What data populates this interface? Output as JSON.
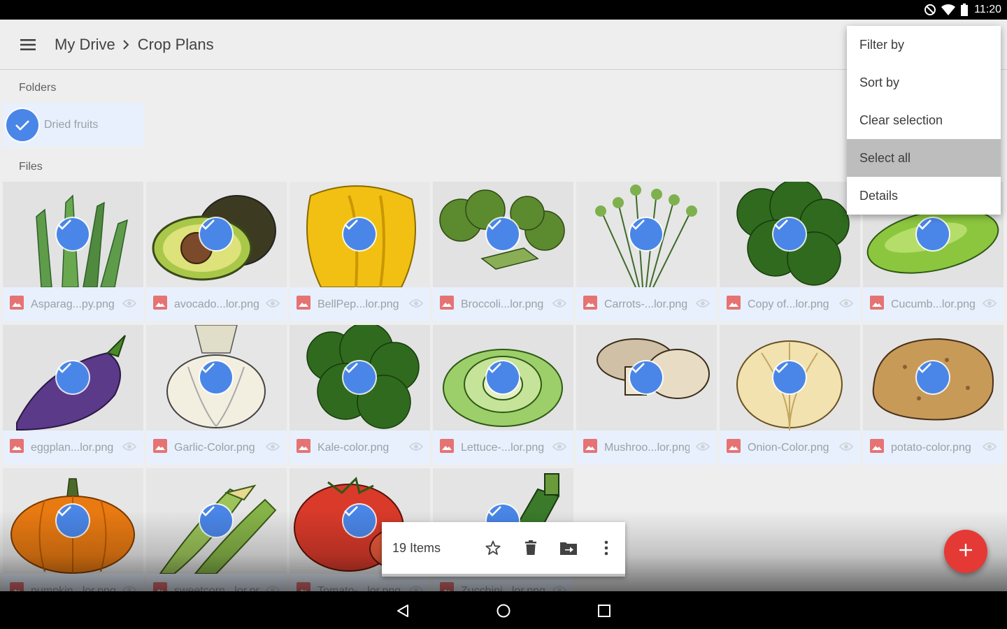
{
  "status_bar": {
    "time": "11:20",
    "icons": [
      "do-not-disturb-icon",
      "wifi-icon",
      "battery-icon"
    ]
  },
  "app_bar": {
    "menu_icon": "hamburger-menu-icon",
    "breadcrumb": [
      "My Drive",
      "Crop Plans"
    ]
  },
  "folders_section": {
    "label": "Folders",
    "items": [
      {
        "name": "Dried fruits",
        "selected": true
      }
    ]
  },
  "files_section": {
    "label": "Files",
    "items": [
      {
        "name": "Asparag...py.png",
        "subject": "asparagus",
        "selected": true
      },
      {
        "name": "avocado...lor.png",
        "subject": "avocado",
        "selected": true
      },
      {
        "name": "BellPep...lor.png",
        "subject": "bell-pepper",
        "selected": true
      },
      {
        "name": "Broccoli...lor.png",
        "subject": "broccoli",
        "selected": true
      },
      {
        "name": "Carrots-...lor.png",
        "subject": "carrots",
        "selected": true
      },
      {
        "name": "Copy of...lor.png",
        "subject": "kale",
        "selected": true
      },
      {
        "name": "Cucumb...lor.png",
        "subject": "cucumber",
        "selected": true
      },
      {
        "name": "eggplan...lor.png",
        "subject": "eggplant",
        "selected": true
      },
      {
        "name": "Garlic-Color.png",
        "subject": "garlic",
        "selected": true
      },
      {
        "name": "Kale-color.png",
        "subject": "kale",
        "selected": true
      },
      {
        "name": "Lettuce-...lor.png",
        "subject": "lettuce",
        "selected": true
      },
      {
        "name": "Mushroo...lor.png",
        "subject": "mushrooms",
        "selected": true
      },
      {
        "name": "Onion-Color.png",
        "subject": "onion",
        "selected": true
      },
      {
        "name": "potato-color.png",
        "subject": "potato",
        "selected": true
      },
      {
        "name": "pumpkin...lor.png",
        "subject": "pumpkin",
        "selected": true
      },
      {
        "name": "sweetcorn...lor.png",
        "subject": "corn",
        "selected": true
      },
      {
        "name": "Tomato-...lor.png",
        "subject": "tomato",
        "selected": true
      },
      {
        "name": "Zucchini...lor.png",
        "subject": "zucchini",
        "selected": true
      }
    ]
  },
  "selection_bar": {
    "count_label": "19 Items",
    "actions": [
      "star-icon",
      "delete-icon",
      "move-to-folder-icon",
      "more-vert-icon"
    ]
  },
  "fab": {
    "icon": "add-icon"
  },
  "overflow_menu": {
    "items": [
      "Filter by",
      "Sort by",
      "Clear selection",
      "Select all",
      "Details"
    ],
    "highlighted": "Select all"
  },
  "nav_bar": {
    "icons": [
      "back-icon",
      "home-icon",
      "recents-icon"
    ]
  },
  "colors": {
    "accent": "#4a86e8",
    "fab": "#e53935",
    "selection_bg": "#e8f0fd",
    "file_icon": "#e57373"
  }
}
